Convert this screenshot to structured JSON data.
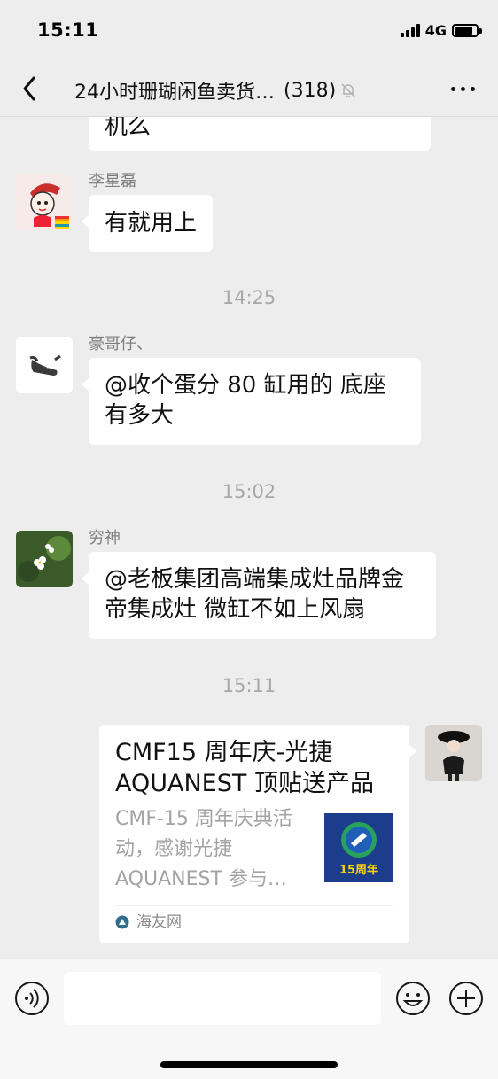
{
  "status_bar": {
    "time": "15:11",
    "network": "4G"
  },
  "header": {
    "title": "24小时珊瑚闲鱼卖货…",
    "member_count": "(318)"
  },
  "messages": {
    "partial_text": "机么",
    "m1": {
      "sender": "李星磊",
      "text": "有就用上"
    },
    "t1": "14:25",
    "m2": {
      "sender": "豪哥仔、",
      "text": "@收个蛋分 80 缸用的 底座有多大"
    },
    "t2": "15:02",
    "m3": {
      "sender": "穷神",
      "text": "@老板集团高端集成灶品牌金帝集成灶 微缸不如上风扇"
    },
    "t3": "15:11",
    "card": {
      "title": "CMF15 周年庆-光捷 AQUANEST 顶贴送产品",
      "description": "CMF-15 周年庆典活动，感谢光捷 AQUANEST 参与…",
      "thumb_text": "15周年",
      "source": "海友网"
    }
  },
  "colors": {
    "background": "#ededed",
    "bubble": "#ffffff",
    "muted_text": "#a8a8a8"
  }
}
